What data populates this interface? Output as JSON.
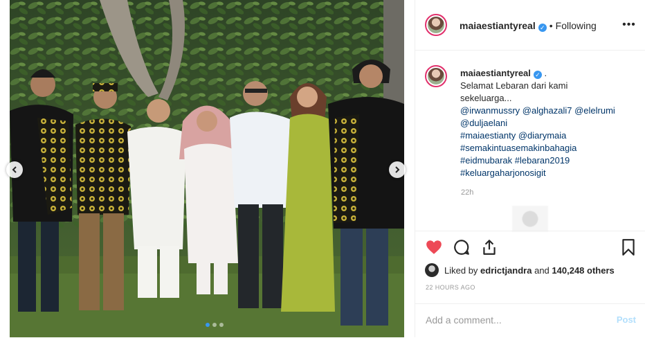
{
  "post": {
    "username": "maiaestiantyreal",
    "verified_mark": "✓",
    "separator": "•",
    "follow_status": "Following",
    "more_label": "•••",
    "caption": {
      "username": "maiaestiantyreal",
      "after_name": ".",
      "lines": [
        "Selamat Lebaran dari kami",
        "sekeluarga..."
      ],
      "tags": [
        "@irwanmussry @alghazali7 @elelrumi",
        "@duljaelani",
        "#maiaestianty @diarymaia",
        "#semakintuasemakinbahagia",
        "#eidmubarak #lebaran2019",
        "#keluargaharjonosigit"
      ],
      "relative_time": "22h"
    },
    "likes": {
      "prefix": "Liked by",
      "liker": "edrictjandra",
      "connector": "and",
      "count": "140,248 others"
    },
    "posted_ago": "22 HOURS AGO",
    "comment_placeholder": "Add a comment...",
    "post_button": "Post"
  },
  "colors": {
    "heart": "#ed4956",
    "link_blue": "#003569",
    "verified_blue": "#3897f0",
    "muted": "#999999"
  },
  "carousel": {
    "slide_count": 3,
    "active_index": 0
  }
}
